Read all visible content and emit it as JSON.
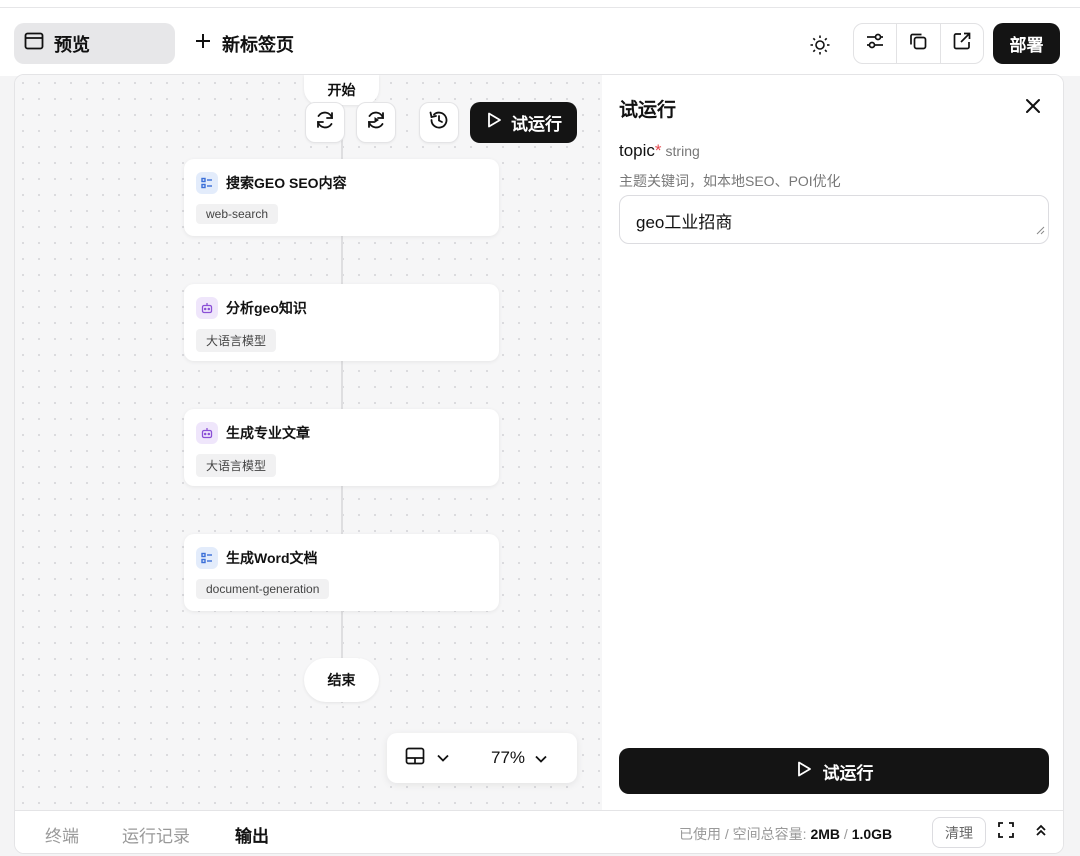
{
  "topbar": {
    "preview_tab": "预览",
    "new_tab": "新标签页",
    "deploy": "部署"
  },
  "canvas": {
    "start": "开始",
    "end": "结束",
    "try_run": "试运行",
    "nodes": [
      {
        "title": "搜索GEO SEO内容",
        "tag": "web-search",
        "icon": "list-icon",
        "color": "#3b6fd8"
      },
      {
        "title": "分析geo知识",
        "tag": "大语言模型",
        "icon": "bot-icon",
        "color": "#8a4fd6"
      },
      {
        "title": "生成专业文章",
        "tag": "大语言模型",
        "icon": "bot-icon",
        "color": "#8a4fd6"
      },
      {
        "title": "生成Word文档",
        "tag": "document-generation",
        "icon": "list-icon",
        "color": "#3b6fd8"
      }
    ],
    "zoom": "77%"
  },
  "panel": {
    "title": "试运行",
    "field_name": "topic",
    "required_mark": "*",
    "field_type": "string",
    "field_hint": "主题关键词，如本地SEO、POI优化",
    "field_value": "geo工业招商",
    "run_button": "试运行"
  },
  "bottom": {
    "tabs": [
      "终端",
      "运行记录",
      "输出"
    ],
    "storage_prefix": "已使用 / 空间总容量: ",
    "used": "2MB",
    "separator": " / ",
    "total": "1.0GB",
    "clear": "清理"
  }
}
